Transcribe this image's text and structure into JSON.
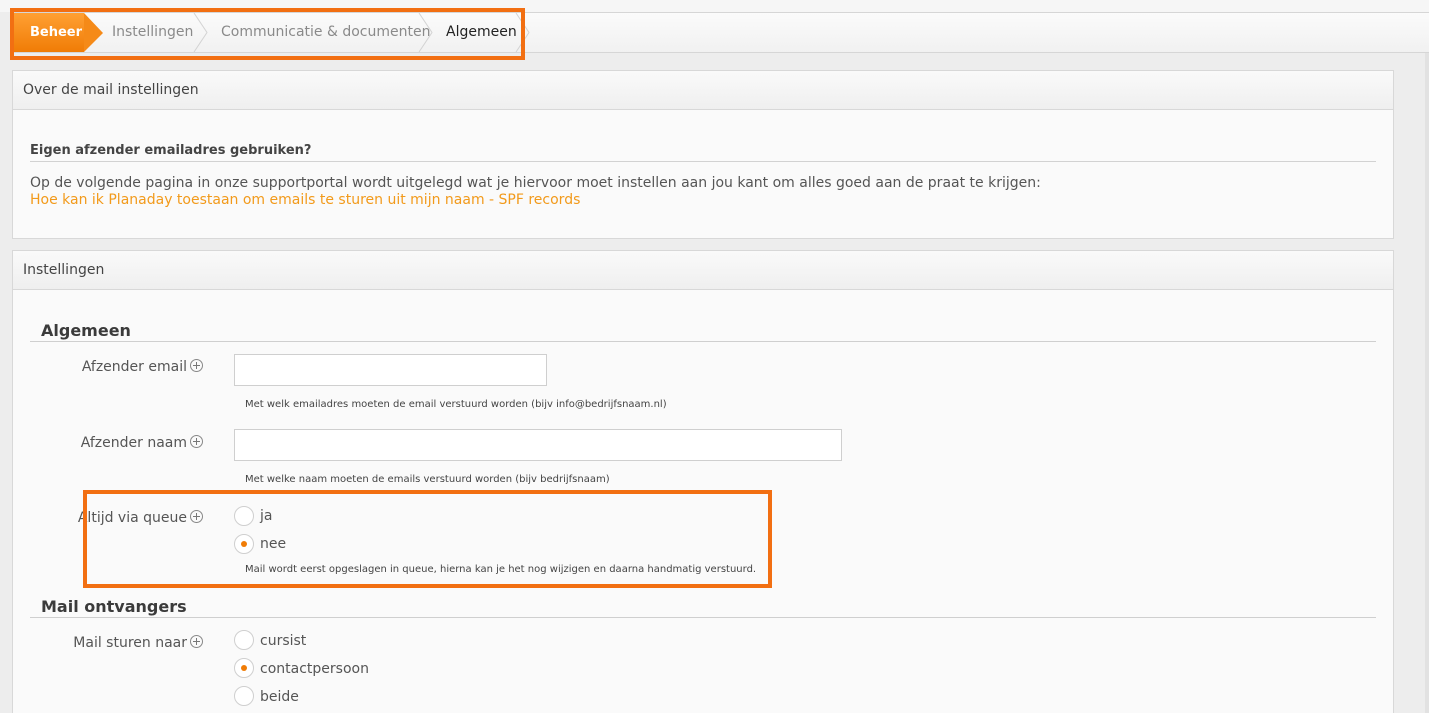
{
  "breadcrumb": {
    "items": [
      {
        "label": "Beheer"
      },
      {
        "label": "Instellingen"
      },
      {
        "label": "Communicatie & documenten"
      },
      {
        "label": "Algemeen"
      }
    ]
  },
  "mail_info_panel": {
    "title": "Over de mail instellingen",
    "question": "Eigen afzender emailadres gebruiken?",
    "description": "Op de volgende pagina in onze supportportal wordt uitgelegd wat je hiervoor moet instellen aan jou kant om alles goed aan de praat te krijgen:",
    "link_text": "Hoe kan ik Planaday toestaan om emails te sturen uit mijn naam - SPF records"
  },
  "settings_panel": {
    "title": "Instellingen",
    "general": {
      "title": "Algemeen",
      "sender_email": {
        "label": "Afzender email",
        "value": "",
        "hint": "Met welk emailadres moeten de email verstuurd worden (bijv info@bedrijfsnaam.nl)"
      },
      "sender_name": {
        "label": "Afzender naam",
        "value": "",
        "hint": "Met welke naam moeten de emails verstuurd worden (bijv bedrijfsnaam)"
      },
      "always_queue": {
        "label": "Altijd via queue",
        "options": [
          {
            "label": "ja",
            "selected": false
          },
          {
            "label": "nee",
            "selected": true
          }
        ],
        "hint": "Mail wordt eerst opgeslagen in queue, hierna kan je het nog wijzigen en daarna handmatig verstuurd."
      }
    },
    "recipients": {
      "title": "Mail ontvangers",
      "send_to": {
        "label": "Mail sturen naar",
        "options": [
          {
            "label": "cursist",
            "selected": false
          },
          {
            "label": "contactpersoon",
            "selected": true
          },
          {
            "label": "beide",
            "selected": false
          }
        ]
      }
    }
  },
  "colors": {
    "accent": "#f07c06",
    "link": "#f29a1b",
    "highlight": "#f26f12"
  }
}
